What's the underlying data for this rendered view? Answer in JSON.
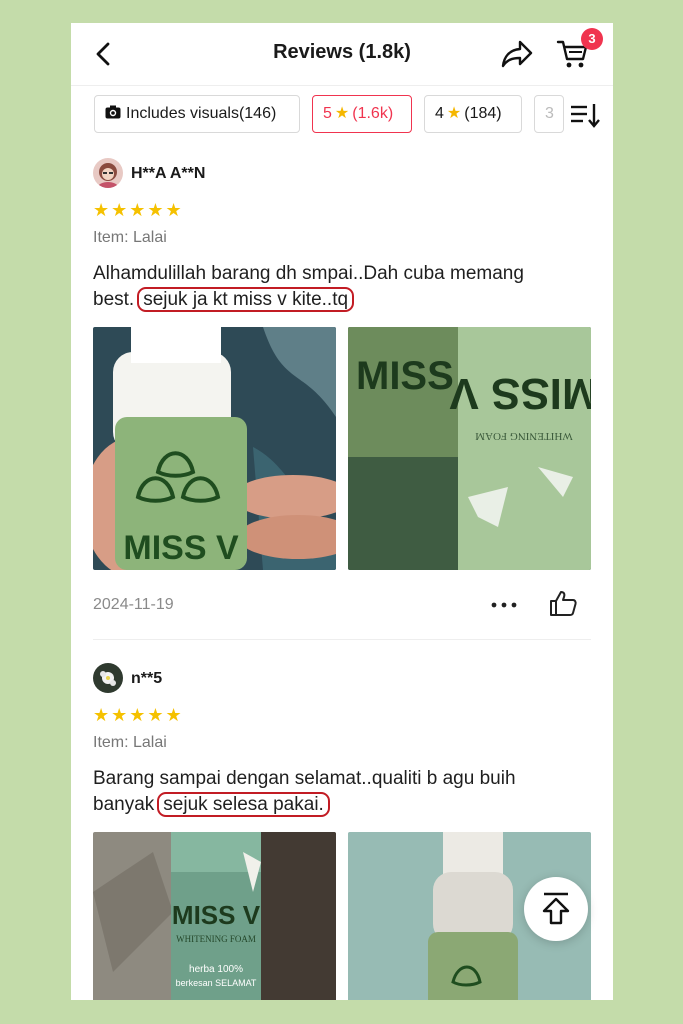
{
  "header": {
    "title": "Reviews (1.8k)",
    "cart_count": "3"
  },
  "filters": {
    "visuals_label": "Includes visuals",
    "visuals_count": "(146)",
    "five_label": "5",
    "five_count": "(1.6k)",
    "four_label": "4",
    "four_count": "(184)",
    "three_label": "3"
  },
  "reviews": [
    {
      "user": "H**A A**N",
      "stars": "★★★★★",
      "item": "Item: Lalai",
      "text_plain": "Alhamdulillah barang dh smpai..Dah cuba memang best.",
      "text_highlight": "sejuk ja kt miss v kite..tq",
      "photo1_brand": "MISS V",
      "photo2_brand": "MISS V",
      "photo2_sub": "WHITENING FOAM",
      "date": "2024-11-19"
    },
    {
      "user": "n**5",
      "stars": "★★★★★",
      "item": "Item: Lalai",
      "text_plain": "Barang sampai dengan selamat..qualiti  b agu buih banyak",
      "text_highlight": "sejuk selesa pakai.",
      "photo1_brand": "MISS V",
      "photo1_sub": "WHITENING FOAM",
      "photo1_tag1": "herba 100%",
      "photo1_tag2": "berkesan SELAMAT"
    }
  ],
  "colors": {
    "accent": "#f0344f",
    "star": "#f5c100",
    "highlight_ring": "#c21c24",
    "background": "#c4dcaa"
  }
}
